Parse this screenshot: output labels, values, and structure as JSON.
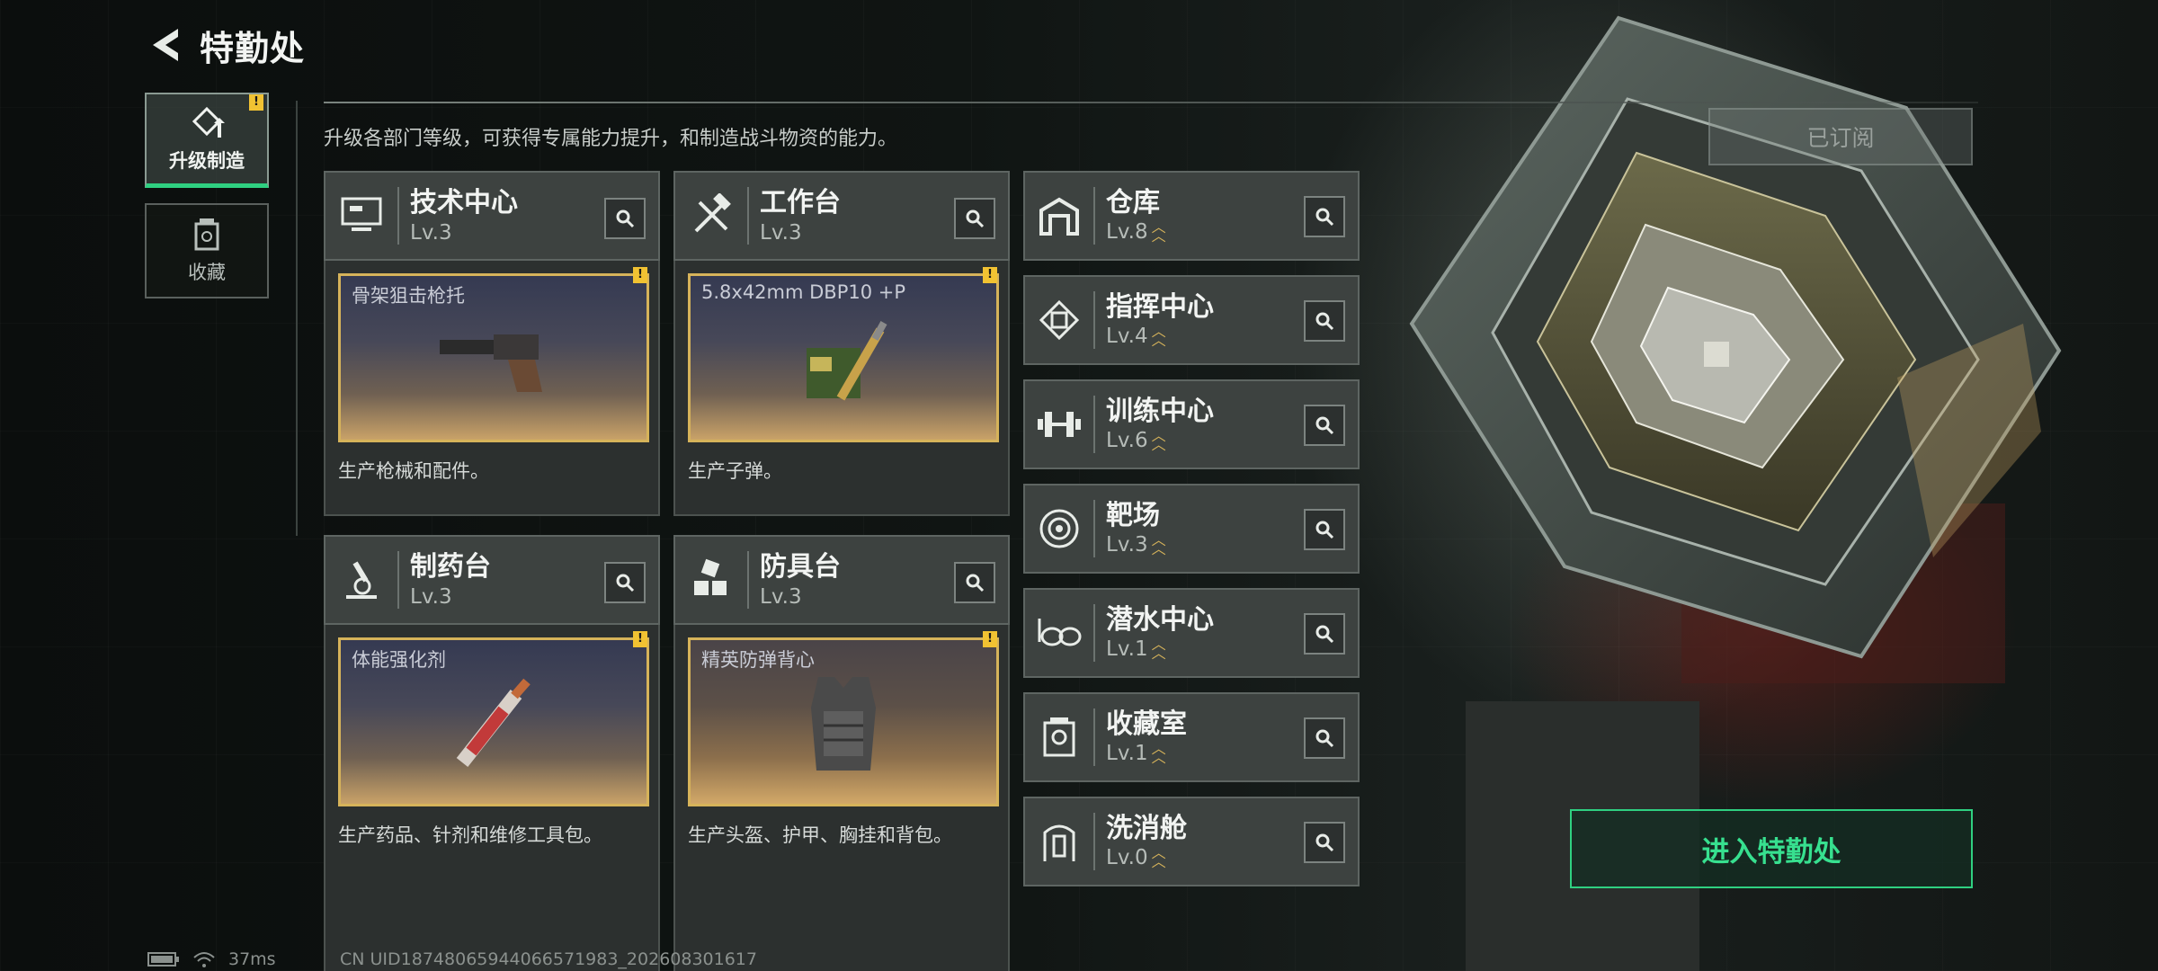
{
  "header": {
    "title": "特勤处"
  },
  "side_tabs": [
    {
      "label": "升级制造",
      "active": true,
      "badge": "!"
    },
    {
      "label": "收藏",
      "active": false
    }
  ],
  "description": "升级各部门等级，可获得专属能力提升，和制造战斗物资的能力。",
  "subscribed_label": "已订阅",
  "facility_cards": [
    {
      "name": "技术中心",
      "level": "Lv.3",
      "item": "骨架狙击枪托",
      "desc": "生产枪械和配件。",
      "icon": "monitor-icon"
    },
    {
      "name": "工作台",
      "level": "Lv.3",
      "item": "5.8x42mm DBP10 +P",
      "desc": "生产子弹。",
      "icon": "tools-icon"
    },
    {
      "name": "制药台",
      "level": "Lv.3",
      "item": "体能强化剂",
      "desc": "生产药品、针剂和维修工具包。",
      "icon": "microscope-icon"
    },
    {
      "name": "防具台",
      "level": "Lv.3",
      "item": "精英防弹背心",
      "desc": "生产头盔、护甲、胸挂和背包。",
      "icon": "boxes-icon"
    }
  ],
  "facility_rows": [
    {
      "name": "仓库",
      "level": "Lv.8",
      "icon": "warehouse-icon"
    },
    {
      "name": "指挥中心",
      "level": "Lv.4",
      "icon": "command-icon"
    },
    {
      "name": "训练中心",
      "level": "Lv.6",
      "icon": "dumbbell-icon"
    },
    {
      "name": "靶场",
      "level": "Lv.3",
      "icon": "target-icon"
    },
    {
      "name": "潜水中心",
      "level": "Lv.1",
      "icon": "goggles-icon"
    },
    {
      "name": "收藏室",
      "level": "Lv.1",
      "icon": "collection-icon"
    },
    {
      "name": "洗消舱",
      "level": "Lv.0",
      "icon": "decon-icon"
    }
  ],
  "enter_button": "进入特勤处",
  "status": {
    "ping": "37ms",
    "uid": "CN UID18748065944066571983_202608301617"
  },
  "colors": {
    "accent": "#2fd081",
    "gold": "#d6b35a",
    "badge": "#f1c232"
  }
}
